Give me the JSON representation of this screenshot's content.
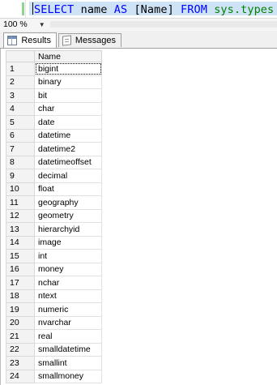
{
  "editor": {
    "query_keyword1": "SELECT",
    "query_plain1": " name ",
    "query_keyword2": "AS",
    "query_plain2": " [Name] ",
    "query_keyword3": "FROM",
    "query_plain3": " ",
    "query_object": "sys.types"
  },
  "zoom": {
    "value": "100 %"
  },
  "tabs": {
    "results": "Results",
    "messages": "Messages"
  },
  "grid": {
    "column_header": "Name",
    "rows": [
      {
        "n": "1",
        "name": "bigint"
      },
      {
        "n": "2",
        "name": "binary"
      },
      {
        "n": "3",
        "name": "bit"
      },
      {
        "n": "4",
        "name": "char"
      },
      {
        "n": "5",
        "name": "date"
      },
      {
        "n": "6",
        "name": "datetime"
      },
      {
        "n": "7",
        "name": "datetime2"
      },
      {
        "n": "8",
        "name": "datetimeoffset"
      },
      {
        "n": "9",
        "name": "decimal"
      },
      {
        "n": "10",
        "name": "float"
      },
      {
        "n": "11",
        "name": "geography"
      },
      {
        "n": "12",
        "name": "geometry"
      },
      {
        "n": "13",
        "name": "hierarchyid"
      },
      {
        "n": "14",
        "name": "image"
      },
      {
        "n": "15",
        "name": "int"
      },
      {
        "n": "16",
        "name": "money"
      },
      {
        "n": "17",
        "name": "nchar"
      },
      {
        "n": "18",
        "name": "ntext"
      },
      {
        "n": "19",
        "name": "numeric"
      },
      {
        "n": "20",
        "name": "nvarchar"
      },
      {
        "n": "21",
        "name": "real"
      },
      {
        "n": "22",
        "name": "smalldatetime"
      },
      {
        "n": "23",
        "name": "smallint"
      },
      {
        "n": "24",
        "name": "smallmoney"
      }
    ]
  }
}
